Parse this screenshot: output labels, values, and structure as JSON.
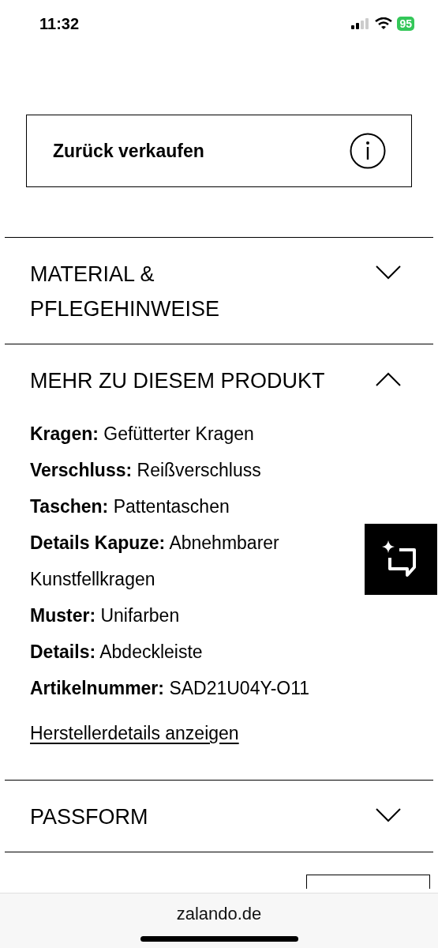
{
  "status_bar": {
    "time": "11:32",
    "battery": "95"
  },
  "resale": {
    "label": "Zurück verkaufen"
  },
  "sections": [
    {
      "title": "MATERIAL & PFLEGEHINWEISE",
      "expanded": false
    },
    {
      "title": "MEHR ZU DIESEM PRODUKT",
      "expanded": true,
      "details": [
        {
          "label": "Kragen:",
          "value": "Gefütterter Kragen"
        },
        {
          "label": "Verschluss:",
          "value": "Reißverschluss"
        },
        {
          "label": "Taschen:",
          "value": "Pattentaschen"
        },
        {
          "label": "Details Kapuze:",
          "value": "Abnehmbarer Kunstfellkragen"
        },
        {
          "label": "Muster:",
          "value": "Unifarben"
        },
        {
          "label": "Details:",
          "value": "Abdeckleiste"
        },
        {
          "label": "Artikelnummer:",
          "value": "SAD21U04Y-O11"
        }
      ],
      "link": "Herstellerdetails anzeigen"
    },
    {
      "title": "PASSFORM",
      "expanded": false
    }
  ],
  "browser_bar": {
    "url": "zalando.de"
  }
}
